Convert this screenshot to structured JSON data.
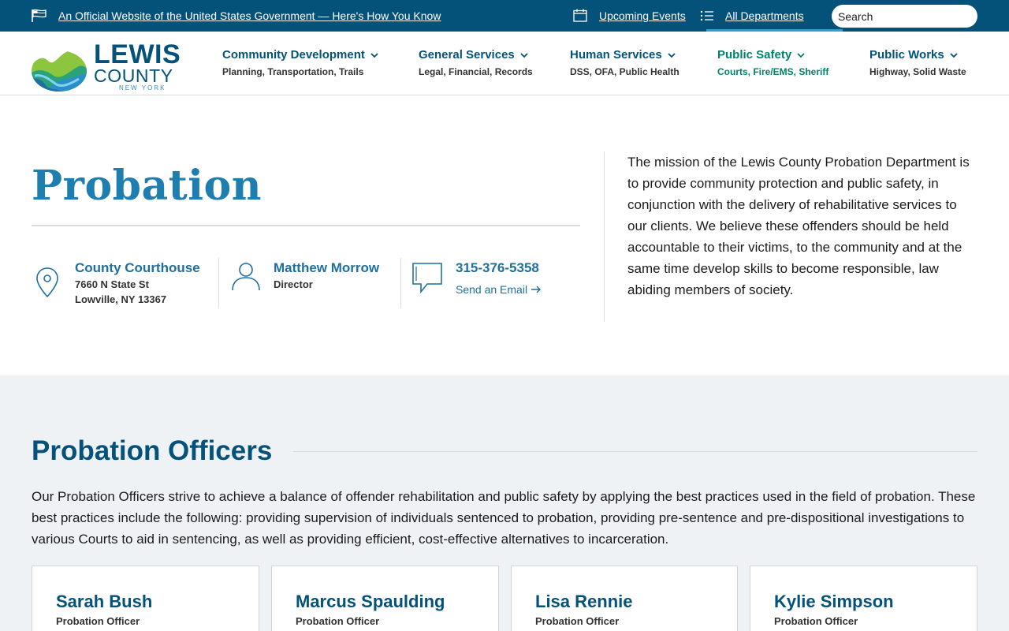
{
  "gov_banner": {
    "official_text": "An Official Website of the United States Government — Here's How You Know",
    "events_label": "Upcoming Events",
    "departments_label": "All Departments",
    "search_placeholder": "Search"
  },
  "logo": {
    "line1": "LEWIS",
    "line2": "COUNTY",
    "line3": "NEW YORK"
  },
  "nav": [
    {
      "title": "Community Development",
      "subtitle": "Planning, Transportation, Trails"
    },
    {
      "title": "General Services",
      "subtitle": "Legal, Financial, Records"
    },
    {
      "title": "Human Services",
      "subtitle": "DSS, OFA, Public Health"
    },
    {
      "title": "Public Safety",
      "subtitle": "Courts, Fire/EMS, Sheriff"
    },
    {
      "title": "Public Works",
      "subtitle": "Highway, Solid Waste"
    }
  ],
  "hero": {
    "title": "Probation",
    "location_name": "County Courthouse",
    "address_line1": "7660 N State St",
    "address_line2": "Lowville, NY 13367",
    "contact_name": "Matthew Morrow",
    "contact_role": "Director",
    "phone": "315-376-5358",
    "email_label": "Send an Email",
    "mission": "The mission of the Lewis County Probation Department is to provide community protection and public safety, in conjunction with the delivery of rehabilitative services to our clients. We believe these offenders should be held accountable to their victims, to the community and at the same time develop skills to become responsible, law abiding members of society."
  },
  "officers": {
    "title": "Probation Officers",
    "description": "Our Probation Officers strive to achieve a balance of offender rehabilitation and public safety by applying the best practices used in the field of probation. These best practices include the following: providing supervision of individuals sentenced to probation, providing pre-sentence and pre-dispositional investigations to various Courts to aid in sentencing, as well as providing efficient, cost-effective alternatives to incarceration.",
    "cards": [
      {
        "name": "Sarah Bush",
        "role": "Probation Officer"
      },
      {
        "name": "Marcus Spaulding",
        "role": "Probation Officer"
      },
      {
        "name": "Lisa Rennie",
        "role": "Probation Officer"
      },
      {
        "name": "Kylie Simpson",
        "role": "Probation Officer"
      }
    ]
  },
  "icons": {
    "banner": [
      "flag-icon",
      "calendar-icon",
      "list-icon"
    ],
    "hero": [
      "location-pin-icon",
      "user-icon",
      "chat-bubble-icon",
      "arrow-right-icon"
    ]
  },
  "colors": {
    "banner_bg": "#045279",
    "primary": "#045279",
    "accent_blue": "#1f7eb0",
    "active_green": "#00836b",
    "section_bg": "#eff2f5"
  }
}
